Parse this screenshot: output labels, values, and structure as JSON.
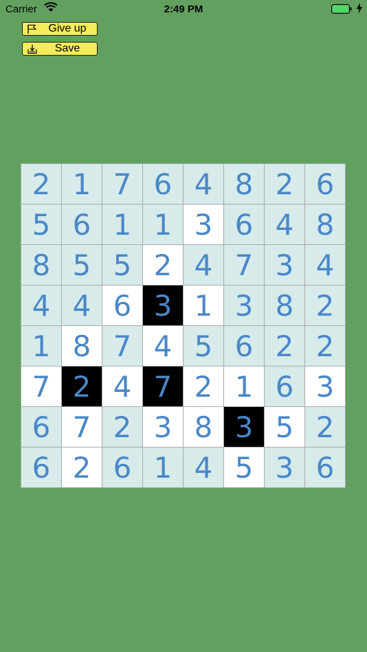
{
  "status_bar": {
    "carrier": "Carrier",
    "time": "2:49 PM"
  },
  "toolbar": {
    "give_up_label": "Give up",
    "save_label": "Save",
    "give_up_icon": "flag-icon",
    "save_icon": "download-tray-icon",
    "button_color": "#f4ec5a"
  },
  "board": {
    "size": 8,
    "colors": {
      "background": "#62a05f",
      "unshaded": "#d6ebea",
      "white": "#ffffff",
      "black": "#000000",
      "digit": "#4a87c8"
    },
    "rows": [
      [
        {
          "v": "2",
          "s": "u"
        },
        {
          "v": "1",
          "s": "u"
        },
        {
          "v": "7",
          "s": "u"
        },
        {
          "v": "6",
          "s": "u"
        },
        {
          "v": "4",
          "s": "u"
        },
        {
          "v": "8",
          "s": "u"
        },
        {
          "v": "2",
          "s": "u"
        },
        {
          "v": "6",
          "s": "u"
        }
      ],
      [
        {
          "v": "5",
          "s": "u"
        },
        {
          "v": "6",
          "s": "u"
        },
        {
          "v": "1",
          "s": "u"
        },
        {
          "v": "1",
          "s": "u"
        },
        {
          "v": "3",
          "s": "w"
        },
        {
          "v": "6",
          "s": "u"
        },
        {
          "v": "4",
          "s": "u"
        },
        {
          "v": "8",
          "s": "u"
        }
      ],
      [
        {
          "v": "8",
          "s": "u"
        },
        {
          "v": "5",
          "s": "u"
        },
        {
          "v": "5",
          "s": "u"
        },
        {
          "v": "2",
          "s": "w"
        },
        {
          "v": "4",
          "s": "u"
        },
        {
          "v": "7",
          "s": "u"
        },
        {
          "v": "3",
          "s": "u"
        },
        {
          "v": "4",
          "s": "u"
        }
      ],
      [
        {
          "v": "4",
          "s": "u"
        },
        {
          "v": "4",
          "s": "u"
        },
        {
          "v": "6",
          "s": "w"
        },
        {
          "v": "3",
          "s": "b"
        },
        {
          "v": "1",
          "s": "w"
        },
        {
          "v": "3",
          "s": "u"
        },
        {
          "v": "8",
          "s": "u"
        },
        {
          "v": "2",
          "s": "u"
        }
      ],
      [
        {
          "v": "1",
          "s": "u"
        },
        {
          "v": "8",
          "s": "w"
        },
        {
          "v": "7",
          "s": "u"
        },
        {
          "v": "4",
          "s": "w"
        },
        {
          "v": "5",
          "s": "u"
        },
        {
          "v": "6",
          "s": "u"
        },
        {
          "v": "2",
          "s": "u"
        },
        {
          "v": "2",
          "s": "u"
        }
      ],
      [
        {
          "v": "7",
          "s": "w"
        },
        {
          "v": "2",
          "s": "b"
        },
        {
          "v": "4",
          "s": "w"
        },
        {
          "v": "7",
          "s": "b"
        },
        {
          "v": "2",
          "s": "w"
        },
        {
          "v": "1",
          "s": "w"
        },
        {
          "v": "6",
          "s": "u"
        },
        {
          "v": "3",
          "s": "w"
        }
      ],
      [
        {
          "v": "6",
          "s": "u"
        },
        {
          "v": "7",
          "s": "w"
        },
        {
          "v": "2",
          "s": "u"
        },
        {
          "v": "3",
          "s": "w"
        },
        {
          "v": "8",
          "s": "w"
        },
        {
          "v": "3",
          "s": "b"
        },
        {
          "v": "5",
          "s": "w"
        },
        {
          "v": "2",
          "s": "u"
        }
      ],
      [
        {
          "v": "6",
          "s": "u"
        },
        {
          "v": "2",
          "s": "w"
        },
        {
          "v": "6",
          "s": "u"
        },
        {
          "v": "1",
          "s": "u"
        },
        {
          "v": "4",
          "s": "u"
        },
        {
          "v": "5",
          "s": "w"
        },
        {
          "v": "3",
          "s": "u"
        },
        {
          "v": "6",
          "s": "u"
        }
      ]
    ]
  }
}
